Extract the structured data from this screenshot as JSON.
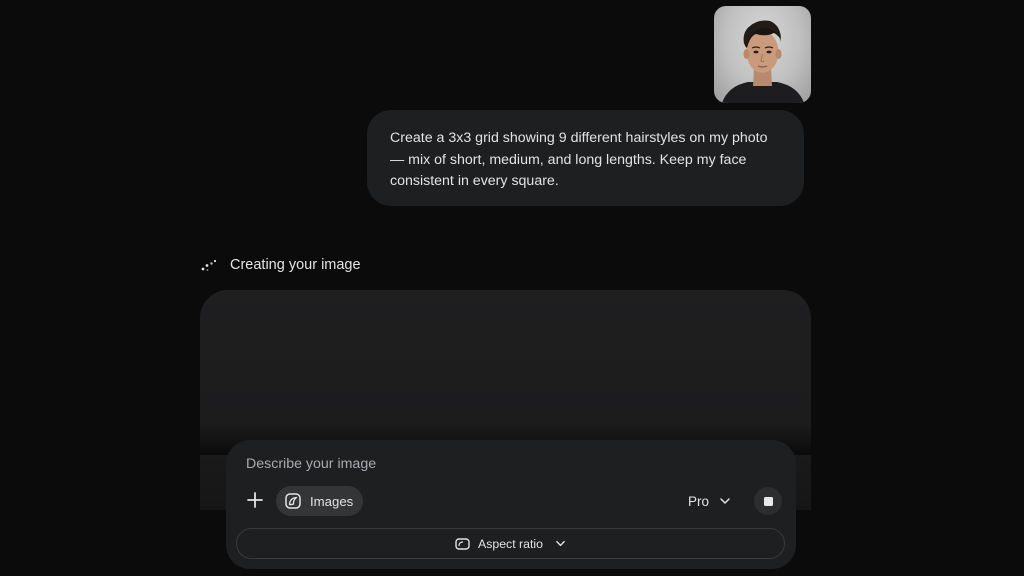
{
  "conversation": {
    "user_message": {
      "text": "Create a 3x3 grid showing 9 different hairstyles on my photo — mix of short, medium, and long lengths. Keep my face consistent in every square."
    },
    "response": {
      "status_text": "Creating your image"
    }
  },
  "composer": {
    "placeholder": "Describe your image",
    "tool_chip_label": "Images",
    "model_label": "Pro",
    "aspect_ratio_label": "Aspect ratio"
  },
  "icons": {
    "add": "plus-icon",
    "images_tool": "image-banana-icon",
    "model_dropdown": "chevron-down-icon",
    "stop": "stop-icon",
    "aspect_ratio": "aspect-ratio-icon",
    "loading": "loading-sparkle-icon"
  },
  "colors": {
    "background": "#0b0b0b",
    "surface": "#1e1f20",
    "chip": "#333537",
    "text": "#e3e3e3",
    "placeholder_text": "#a8abaf"
  }
}
